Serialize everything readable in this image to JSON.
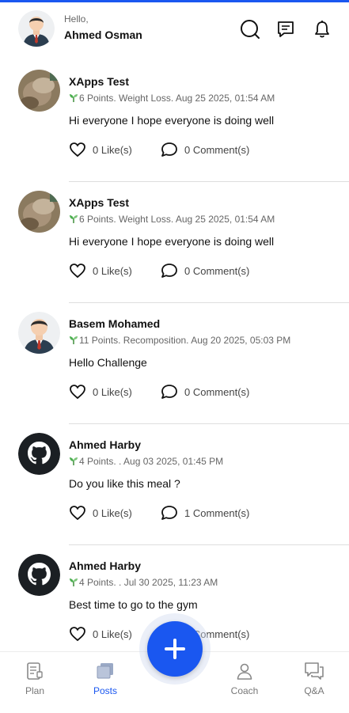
{
  "header": {
    "greeting": "Hello,",
    "user_name": "Ahmed Osman",
    "icons": [
      "search-icon",
      "message-icon",
      "bell-icon"
    ]
  },
  "posts": [
    {
      "author": "XApps Test",
      "meta": "6 Points. Weight Loss. Aug 25 2025, 01:54 AM",
      "body": "Hi everyone I hope everyone is doing well",
      "likes": "0 Like(s)",
      "comments": "0 Comment(s)",
      "avatar": "photo"
    },
    {
      "author": "XApps Test",
      "meta": "6 Points. Weight Loss. Aug 25 2025, 01:54 AM",
      "body": "Hi everyone I hope everyone is doing well",
      "likes": "0 Like(s)",
      "comments": "0 Comment(s)",
      "avatar": "photo"
    },
    {
      "author": "Basem Mohamed",
      "meta": "11 Points. Recomposition. Aug 20 2025, 05:03 PM",
      "body": "Hello Challenge",
      "likes": "0 Like(s)",
      "comments": "0 Comment(s)",
      "avatar": "person"
    },
    {
      "author": "Ahmed Harby",
      "meta": "4 Points. . Aug 03 2025, 01:45 PM",
      "body": "Do you like this meal ?",
      "likes": "0 Like(s)",
      "comments": "1 Comment(s)",
      "avatar": "github"
    },
    {
      "author": "Ahmed Harby",
      "meta": "4 Points. . Jul 30 2025, 11:23 AM",
      "body": "Best time to go to the gym",
      "likes": "0 Like(s)",
      "comments": "0 Comment(s)",
      "avatar": "github"
    }
  ],
  "tabs": [
    {
      "label": "Plan",
      "icon": "plan-icon",
      "active": false
    },
    {
      "label": "Posts",
      "icon": "posts-icon",
      "active": true
    },
    {
      "label": "Coach",
      "icon": "coach-icon",
      "active": false
    },
    {
      "label": "Q&A",
      "icon": "qa-icon",
      "active": false
    }
  ],
  "fab": {
    "icon": "plus-icon"
  },
  "colors": {
    "accent": "#1a57f0",
    "divider": "#dedede",
    "muted": "#666666"
  }
}
